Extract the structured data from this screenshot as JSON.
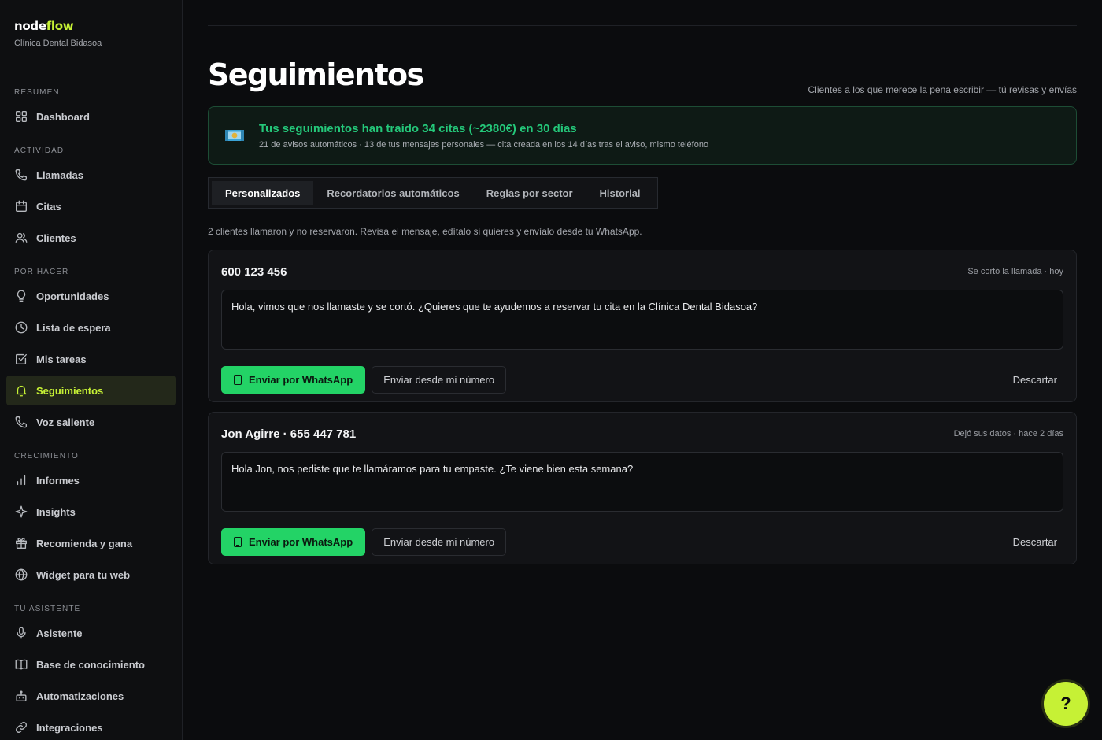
{
  "brand": {
    "name_a": "node",
    "name_b": "flow",
    "org": "Clínica Dental Bidasoa"
  },
  "sidebar": {
    "sections": [
      {
        "title": "RESUMEN",
        "items": [
          {
            "label": "Dashboard",
            "icon": "grid-icon"
          }
        ]
      },
      {
        "title": "ACTIVIDAD",
        "items": [
          {
            "label": "Llamadas",
            "icon": "phone-icon"
          },
          {
            "label": "Citas",
            "icon": "calendar-icon"
          },
          {
            "label": "Clientes",
            "icon": "users-icon"
          }
        ]
      },
      {
        "title": "POR HACER",
        "items": [
          {
            "label": "Oportunidades",
            "icon": "lightbulb-icon"
          },
          {
            "label": "Lista de espera",
            "icon": "clock-icon"
          },
          {
            "label": "Mis tareas",
            "icon": "checkbox-icon"
          },
          {
            "label": "Seguimientos",
            "icon": "bell-icon",
            "active": true
          },
          {
            "label": "Voz saliente",
            "icon": "phone-outgoing-icon"
          }
        ]
      },
      {
        "title": "CRECIMIENTO",
        "items": [
          {
            "label": "Informes",
            "icon": "bar-chart-icon"
          },
          {
            "label": "Insights",
            "icon": "sparkle-icon"
          },
          {
            "label": "Recomienda y gana",
            "icon": "gift-icon"
          },
          {
            "label": "Widget para tu web",
            "icon": "globe-icon"
          }
        ]
      },
      {
        "title": "TU ASISTENTE",
        "items": [
          {
            "label": "Asistente",
            "icon": "microphone-icon"
          },
          {
            "label": "Base de conocimiento",
            "icon": "book-icon"
          },
          {
            "label": "Automatizaciones",
            "icon": "robot-icon"
          },
          {
            "label": "Integraciones",
            "icon": "link-icon"
          }
        ]
      }
    ]
  },
  "header": {
    "title": "Seguimientos",
    "subtitle": "Clientes a los que merece la pena escribir — tú revisas y envías"
  },
  "banner": {
    "icon": "money-icon",
    "title": "Tus seguimientos han traído 34 citas (~2380€) en 30 días",
    "subtitle": "21 de avisos automáticos · 13 de tus mensajes personales — cita creada en los 14 días tras el aviso, mismo teléfono"
  },
  "tabs": [
    {
      "label": "Personalizados",
      "active": true
    },
    {
      "label": "Recordatorios automáticos"
    },
    {
      "label": "Reglas por sector"
    },
    {
      "label": "Historial"
    }
  ],
  "hint": "2 clientes llamaron y no reservaron. Revisa el mensaje, edítalo si quieres y envíalo desde tu WhatsApp.",
  "cards": [
    {
      "title": "600 123 456",
      "meta": "Se cortó la llamada · hoy",
      "message": "Hola, vimos que nos llamaste y se cortó. ¿Quieres que te ayudemos a reservar tu cita en la Clínica Dental Bidasoa?",
      "send_wa": "Enviar por WhatsApp",
      "send_own": "Enviar desde mi número",
      "discard": "Descartar"
    },
    {
      "title": "Jon Agirre · 655 447 781",
      "meta": "Dejó sus datos · hace 2 días",
      "message": "Hola Jon, nos pediste que te llamáramos para tu empaste. ¿Te viene bien esta semana?",
      "send_wa": "Enviar por WhatsApp",
      "send_own": "Enviar desde mi número",
      "discard": "Descartar"
    }
  ],
  "help": {
    "label": "?"
  },
  "colors": {
    "accent": "#c6f135",
    "whatsapp": "#23d366",
    "success_text": "#24c87a"
  }
}
